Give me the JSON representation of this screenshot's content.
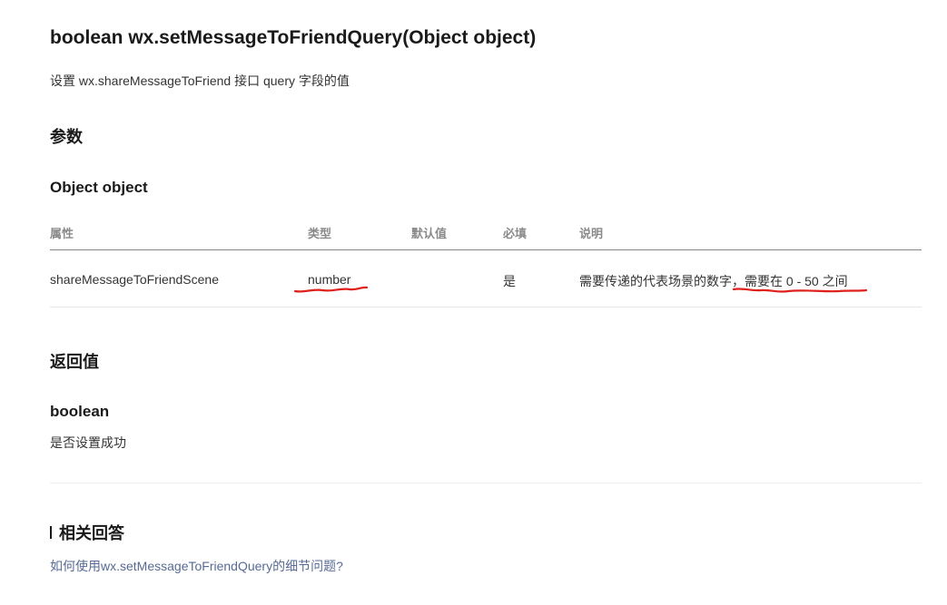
{
  "api": {
    "title": "boolean wx.setMessageToFriendQuery(Object object)",
    "description": "设置 wx.shareMessageToFriend 接口 query 字段的值"
  },
  "params": {
    "heading": "参数",
    "object_title": "Object object",
    "headers": [
      "属性",
      "类型",
      "默认值",
      "必填",
      "说明"
    ],
    "rows": [
      {
        "name": "shareMessageToFriendScene",
        "type": "number",
        "default": "",
        "required": "是",
        "desc_a": "需要传递的代表场景的数字，",
        "desc_b": "需要在 0 - 50 之间"
      }
    ]
  },
  "returns": {
    "heading": "返回值",
    "type": "boolean",
    "description": "是否设置成功"
  },
  "related": {
    "heading": "相关回答",
    "link": "如何使用wx.setMessageToFriendQuery的细节问题?"
  },
  "colors": {
    "link": "#576b95",
    "annotation": "#e0201a"
  }
}
